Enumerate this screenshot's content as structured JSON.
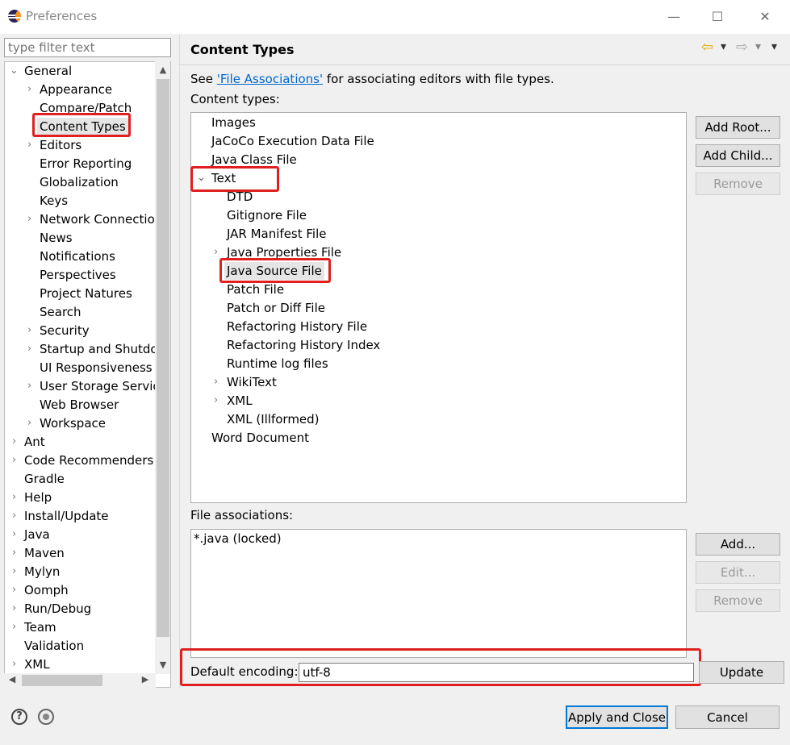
{
  "window": {
    "title": "Preferences",
    "minimize": "—",
    "maximize": "☐",
    "close": "✕"
  },
  "filter": {
    "placeholder": "type filter text"
  },
  "nav": {
    "items": [
      "General",
      "Appearance",
      "Compare/Patch",
      "Content Types",
      "Editors",
      "Error Reporting",
      "Globalization",
      "Keys",
      "Network Connectio",
      "News",
      "Notifications",
      "Perspectives",
      "Project Natures",
      "Search",
      "Security",
      "Startup and Shutdo",
      "UI Responsiveness M",
      "User Storage Servic",
      "Web Browser",
      "Workspace",
      "Ant",
      "Code Recommenders",
      "Gradle",
      "Help",
      "Install/Update",
      "Java",
      "Maven",
      "Mylyn",
      "Oomph",
      "Run/Debug",
      "Team",
      "Validation",
      "XML"
    ]
  },
  "page": {
    "title": "Content Types",
    "see_prefix": "See",
    "link_text": "'File Associations'",
    "see_suffix": "for associating editors with file types.",
    "content_types_label": "Content types:",
    "file_assoc_label": "File associations:",
    "encoding_label": "Default encoding:",
    "encoding_value": "utf-8"
  },
  "content_types": [
    "Images",
    "JaCoCo Execution Data File",
    "Java Class File",
    "Text",
    "DTD",
    "Gitignore File",
    "JAR Manifest File",
    "Java Properties File",
    "Java Source File",
    "Patch File",
    "Patch or Diff File",
    "Refactoring History File",
    "Refactoring History Index",
    "Runtime log files",
    "WikiText",
    "XML",
    "XML (Illformed)",
    "Word Document"
  ],
  "file_associations": [
    "*.java (locked)"
  ],
  "buttons": {
    "add_root": "Add Root...",
    "add_child": "Add Child...",
    "remove_ct": "Remove",
    "add": "Add...",
    "edit": "Edit...",
    "remove_fa": "Remove",
    "update": "Update",
    "apply_close": "Apply and Close",
    "cancel": "Cancel"
  },
  "glyphs": {
    "expanded": "⌄",
    "collapsed": "›",
    "back": "⇦",
    "forward": "⇨",
    "dropdown": "▾",
    "help": "?"
  },
  "colors": {
    "highlight": "#e02020",
    "link": "#0066cc",
    "back_arrow": "#e8a800"
  }
}
